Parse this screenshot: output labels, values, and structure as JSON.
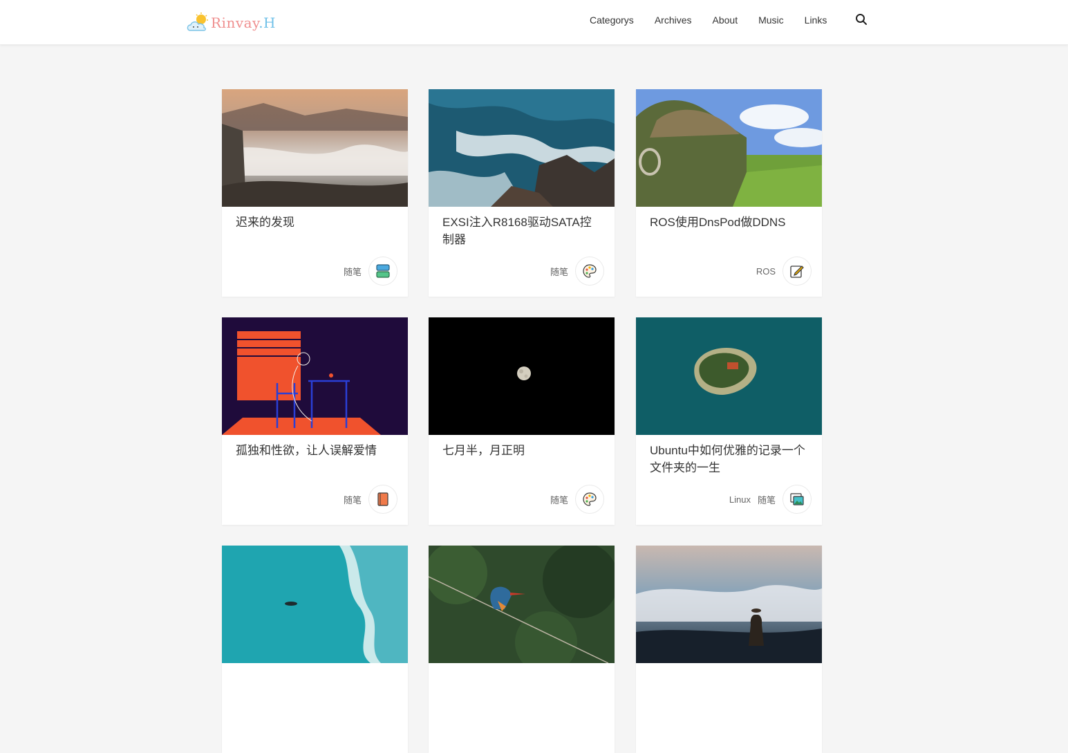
{
  "brand": {
    "logo_part1": "Rinvay",
    "logo_part2": ".H"
  },
  "nav": {
    "items": [
      "Categorys",
      "Archives",
      "About",
      "Music",
      "Links"
    ]
  },
  "posts": [
    {
      "title": "迟来的发现",
      "tags": [
        "随笔"
      ],
      "icon": "stack-icon"
    },
    {
      "title": "EXSI注入R8168驱动SATA控制器",
      "tags": [
        "随笔"
      ],
      "icon": "palette-icon"
    },
    {
      "title": "ROS使用DnsPod做DDNS",
      "tags": [
        "ROS"
      ],
      "icon": "edit-icon"
    },
    {
      "title": "孤独和性欲，让人误解爱情",
      "tags": [
        "随笔"
      ],
      "icon": "book-icon"
    },
    {
      "title": "七月半，月正明",
      "tags": [
        "随笔"
      ],
      "icon": "palette-icon"
    },
    {
      "title": "Ubuntu中如何优雅的记录一个文件夹的一生",
      "tags": [
        "Linux",
        "随笔"
      ],
      "icon": "gallery-icon"
    },
    {
      "title": "",
      "tags": [],
      "icon": ""
    },
    {
      "title": "",
      "tags": [],
      "icon": ""
    },
    {
      "title": "",
      "tags": [],
      "icon": ""
    }
  ],
  "colors": {
    "background": "#f5f5f5",
    "card": "#ffffff",
    "text": "#333333",
    "muted": "#666666"
  }
}
